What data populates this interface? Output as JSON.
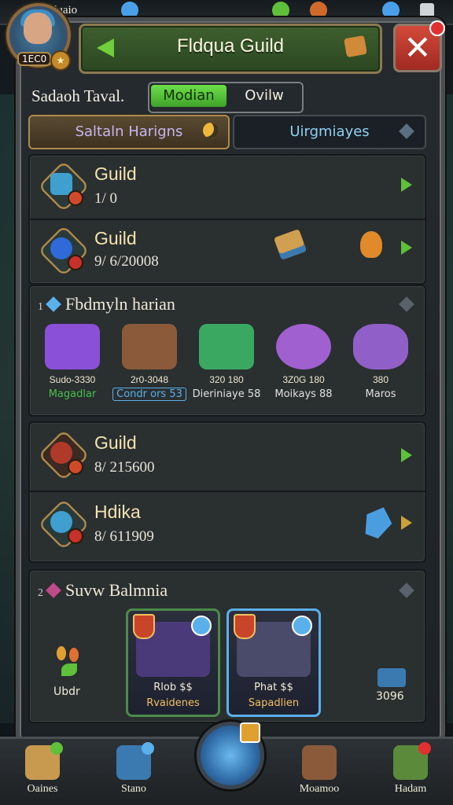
{
  "topbar": {
    "currency_label": "Moduaio",
    "level_text": "1EC0"
  },
  "header": {
    "title": "Fldqua Guild"
  },
  "row1": {
    "label": "Sadaoh Taval.",
    "toggle_on": "Modian",
    "toggle_off": "Ovilw"
  },
  "segments": {
    "left": "Saltaln Harigns",
    "right": "Uirgmiayes"
  },
  "guild_items": [
    {
      "name": "Guild",
      "value": "1/ 0",
      "badge_color": "#3fa0d0"
    },
    {
      "name": "Guild",
      "value": "9/ 6/20008",
      "badge_color": "#2f6ad8"
    }
  ],
  "rewards_section": {
    "number": "1",
    "title": "Fbdmyln harian",
    "items": [
      {
        "price": "Sudo-3330",
        "tag": "Magadlar",
        "tag_color": "#46c04a",
        "art_color": "#8a50d8"
      },
      {
        "price": "2r0-3048",
        "tag": "Condr ors 53",
        "tag_color": "#5ab0ea",
        "art_color": "#8a5a3a"
      },
      {
        "price": "320 180",
        "tag": "Dieriniaye 58",
        "tag_color": "#e0e0e0",
        "art_color": "#3aa860"
      },
      {
        "price": "3Z0G 180",
        "tag": "Moikays 88",
        "tag_color": "#e0e0e0",
        "art_color": "#a060d0"
      },
      {
        "price": "380",
        "tag": "Maros",
        "tag_color": "#e0e0e0",
        "art_color": "#9060c8"
      }
    ]
  },
  "member_items": [
    {
      "name": "Guild",
      "value": "8/ 215600",
      "badge_color": "#b03a2a"
    },
    {
      "name": "Hdika",
      "value": "8/ 611909",
      "badge_color": "#3fa0d0"
    }
  ],
  "bonus_section": {
    "number": "2",
    "title": "Suvw Balmnia",
    "left_label": "Ubdr",
    "right_label": "3096",
    "cards": [
      {
        "price": "Rlob $$",
        "qual": "Rvaidenes",
        "qual_color": "#f0c060",
        "border": "#4a8a4a",
        "art": "#4a3a7a"
      },
      {
        "price": "Phat $$",
        "qual": "Sapadlien",
        "qual_color": "#f0c060",
        "border": "#5ab0ea",
        "art": "#4a4a6a"
      }
    ]
  },
  "bottom_nav": {
    "items": [
      "Oaines",
      "Stano",
      "Moamoo",
      "Hadam"
    ]
  },
  "colors": {
    "accent_green": "#5fc03a",
    "gold": "#b08a4a",
    "close_red": "#d24a3a"
  }
}
